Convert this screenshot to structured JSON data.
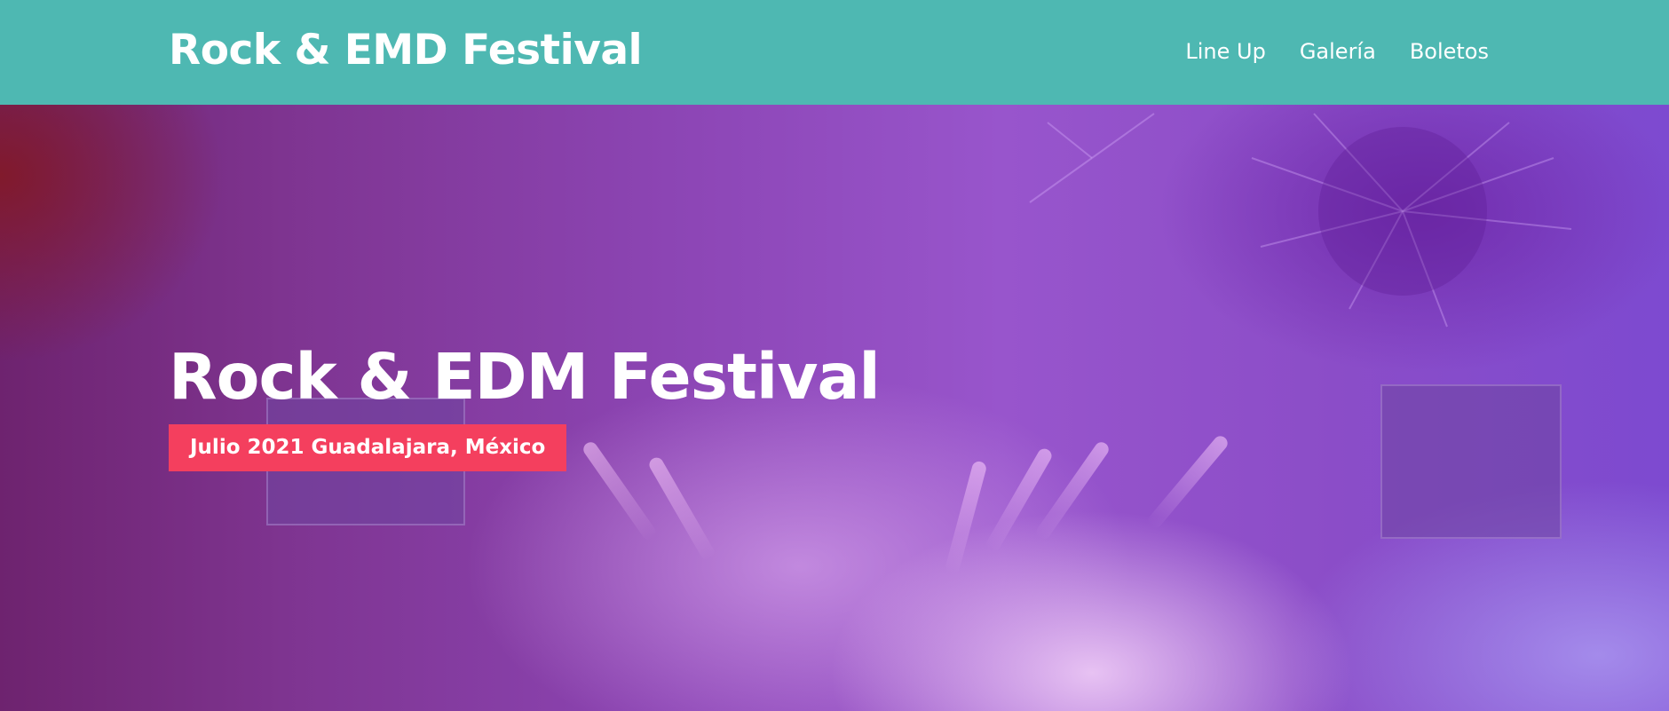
{
  "header": {
    "site_title": "Rock & EMD Festival",
    "nav": [
      {
        "label": "Line Up"
      },
      {
        "label": "Galería"
      },
      {
        "label": "Boletos"
      }
    ]
  },
  "hero": {
    "title": "Rock & EDM Festival",
    "badge": "Julio 2021 Guadalajara, México"
  },
  "colors": {
    "header_bg": "#4eb8b2",
    "badge_bg": "#f43f5e",
    "text": "#ffffff"
  }
}
